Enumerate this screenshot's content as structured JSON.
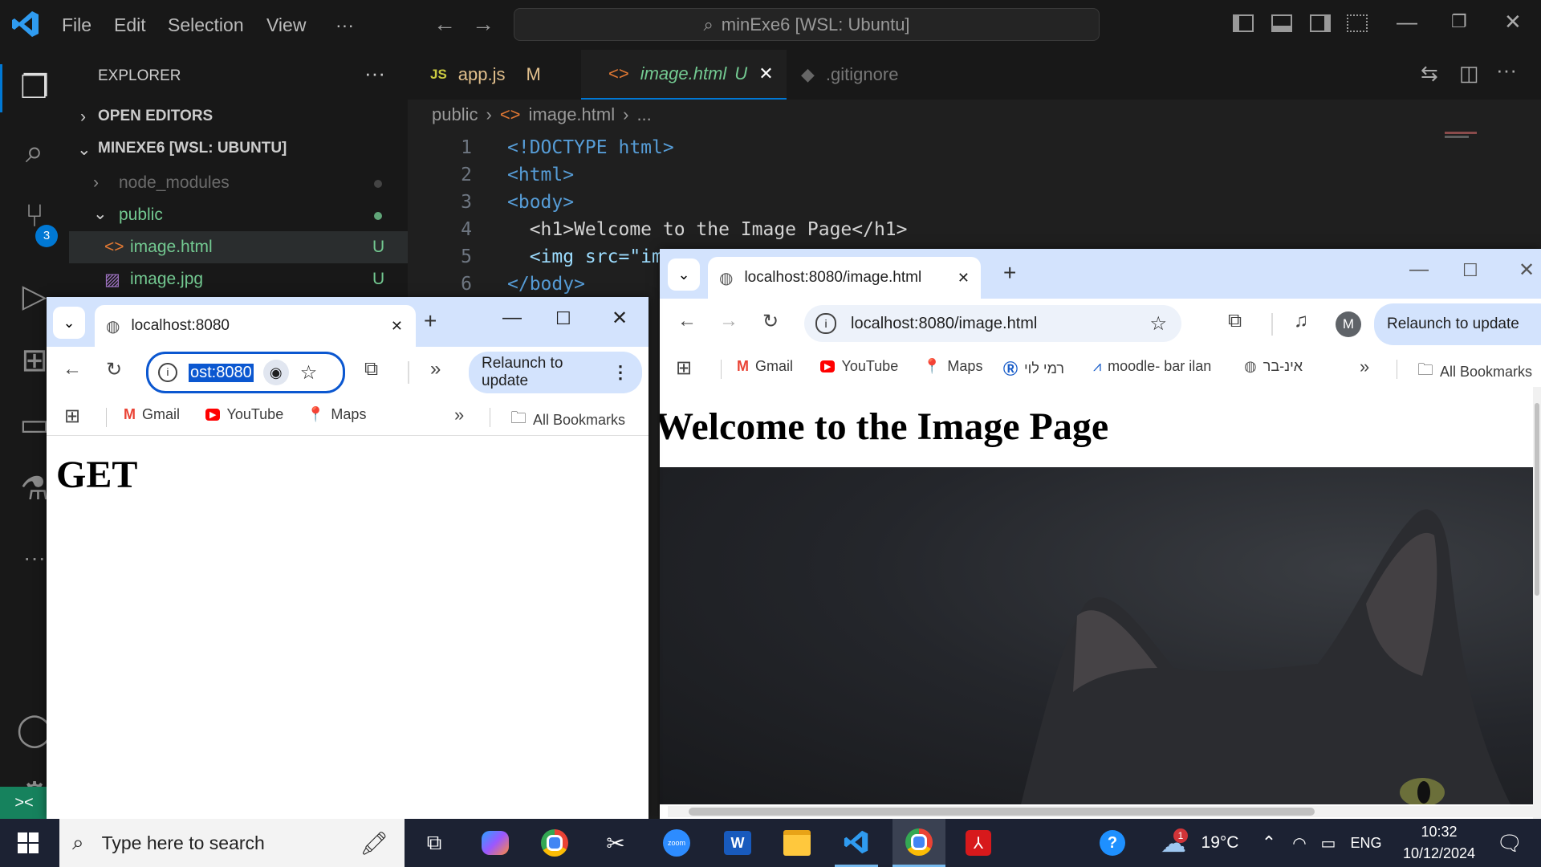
{
  "vscode": {
    "menu": [
      "File",
      "Edit",
      "Selection",
      "View",
      "···"
    ],
    "command_center": "minExe6 [WSL: Ubuntu]",
    "explorer_title": "EXPLORER",
    "open_editors": "OPEN EDITORS",
    "workspace": "MINEXE6 [WSL: UBUNTU]",
    "tree": [
      {
        "label": "node_modules",
        "status": ""
      },
      {
        "label": "public",
        "status": ""
      },
      {
        "label": "image.html",
        "status": "U"
      },
      {
        "label": "image.jpg",
        "status": "U"
      }
    ],
    "source_control_badge": "3",
    "tabs": [
      {
        "label": "app.js",
        "status": "M",
        "icon": "JS"
      },
      {
        "label": "image.html",
        "status": "U"
      },
      {
        "label": ".gitignore",
        "status": ""
      }
    ],
    "breadcrumb": [
      "public",
      "image.html",
      "..."
    ],
    "code_lines": [
      {
        "n": "1",
        "text": "<!DOCTYPE html>"
      },
      {
        "n": "2",
        "text": "<html>"
      },
      {
        "n": "3",
        "text": "<body>"
      },
      {
        "n": "4",
        "text": "  <h1>Welcome to the Image Page</h1>"
      },
      {
        "n": "5",
        "text": "  <img src=\"im"
      },
      {
        "n": "6",
        "text": "</body>"
      }
    ],
    "statusbar_remote": "><"
  },
  "chrome_left": {
    "tab_title": "localhost:8080",
    "address_selected": "ost:8080",
    "relaunch": "Relaunch to update",
    "bookmarks": [
      "Gmail",
      "YouTube",
      "Maps"
    ],
    "all_bookmarks": "All Bookmarks",
    "content": "GET"
  },
  "chrome_right": {
    "tab_title": "localhost:8080/image.html",
    "address": "localhost:8080/image.html",
    "profile": "M",
    "relaunch": "Relaunch to update",
    "bookmarks": [
      "Gmail",
      "YouTube",
      "Maps",
      "רמי לוי",
      "moodle- bar ilan",
      "אינ-בר"
    ],
    "all_bookmarks": "All Bookmarks",
    "heading": "Welcome to the Image Page"
  },
  "taskbar": {
    "search_placeholder": "Type here to search",
    "weather_temp": "19°C",
    "weather_badge": "1",
    "language": "ENG",
    "time": "10:32",
    "date": "10/12/2024",
    "zoom_label": "zoom",
    "word_label": "W"
  }
}
